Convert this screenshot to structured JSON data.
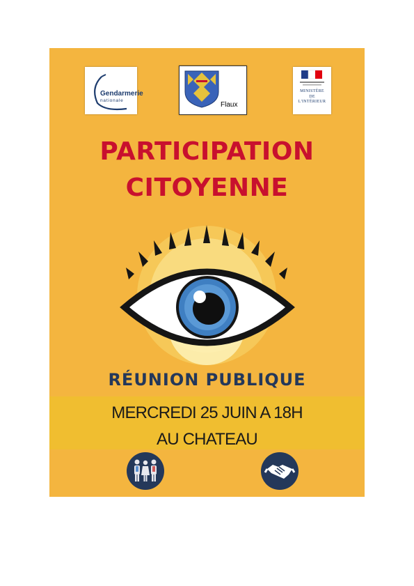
{
  "logos": {
    "gendarmerie": {
      "name": "Gendarmerie",
      "subtitle": "nationale"
    },
    "flaux": {
      "label": "Flaux"
    },
    "ministere": {
      "lines": [
        "MINISTÈRE",
        "DE",
        "L'INTÉRIEUR"
      ]
    }
  },
  "title": {
    "line1": "PARTICIPATION",
    "line2": "CITOYENNE"
  },
  "event": {
    "heading": "RÉUNION PUBLIQUE",
    "date": "MERCREDI 25 JUIN A 18H",
    "place": "AU CHATEAU"
  },
  "colors": {
    "background": "#f4b53f",
    "title": "#c8102e",
    "heading": "#24385a",
    "band": "#f0be30"
  },
  "icons": [
    "gendarmerie-logo",
    "coat-of-arms-icon",
    "ministry-logo",
    "eye-icon",
    "people-icon",
    "handshake-icon"
  ]
}
